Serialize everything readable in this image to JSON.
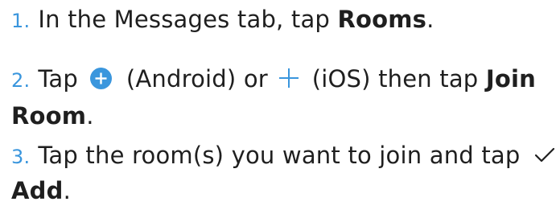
{
  "steps": [
    {
      "number": "1.",
      "text_a": "In the Messages tab, tap ",
      "bold_a": "Rooms",
      "text_b": "."
    },
    {
      "number": "2.",
      "text_a": "Tap ",
      "text_b": " (Android) or ",
      "text_c": " (iOS) then tap ",
      "bold_a": "Join",
      "bold_b": "Room",
      "text_d": "."
    },
    {
      "number": "3.",
      "text_a": "Tap the room(s) you want to join and tap ",
      "bold_a": "Add",
      "text_b": "."
    }
  ],
  "icons": {
    "android_add": "plus-circle-icon",
    "ios_add": "plus-icon",
    "confirm": "checkmark-icon"
  },
  "colors": {
    "accent": "#3a96dd",
    "text": "#1f1f1f"
  }
}
